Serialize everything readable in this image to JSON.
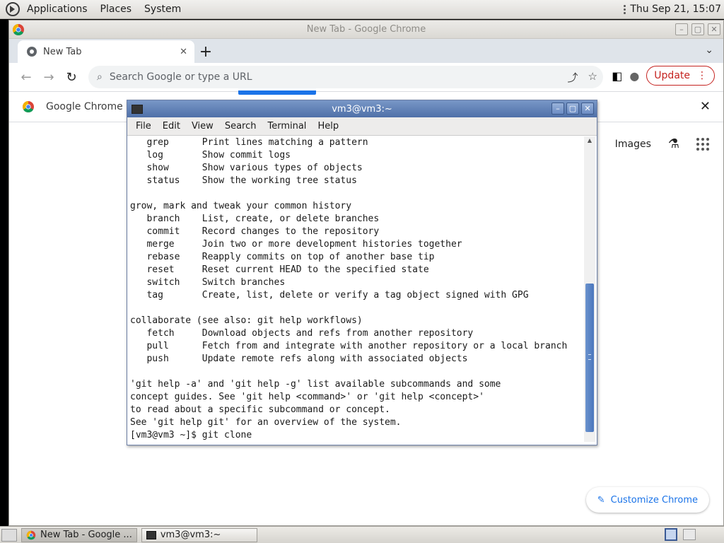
{
  "top_panel": {
    "menus": [
      "Applications",
      "Places",
      "System"
    ],
    "clock": "Thu Sep 21, 15:07"
  },
  "chrome": {
    "window_title": "New Tab - Google Chrome",
    "tab_title": "New Tab",
    "omnibox_placeholder": "Search Google or type a URL",
    "update_label": "Update",
    "infobar_text": "Google Chrome is",
    "images_label": "Images",
    "customize_label": "Customize Chrome"
  },
  "terminal": {
    "title": "vm3@vm3:~",
    "menus": [
      "File",
      "Edit",
      "View",
      "Search",
      "Terminal",
      "Help"
    ],
    "lines": [
      "   grep      Print lines matching a pattern",
      "   log       Show commit logs",
      "   show      Show various types of objects",
      "   status    Show the working tree status",
      "",
      "grow, mark and tweak your common history",
      "   branch    List, create, or delete branches",
      "   commit    Record changes to the repository",
      "   merge     Join two or more development histories together",
      "   rebase    Reapply commits on top of another base tip",
      "   reset     Reset current HEAD to the specified state",
      "   switch    Switch branches",
      "   tag       Create, list, delete or verify a tag object signed with GPG",
      "",
      "collaborate (see also: git help workflows)",
      "   fetch     Download objects and refs from another repository",
      "   pull      Fetch from and integrate with another repository or a local branch",
      "   push      Update remote refs along with associated objects",
      "",
      "'git help -a' and 'git help -g' list available subcommands and some",
      "concept guides. See 'git help <command>' or 'git help <concept>'",
      "to read about a specific subcommand or concept.",
      "See 'git help git' for an overview of the system.",
      "[vm3@vm3 ~]$ git clone "
    ]
  },
  "taskbar": {
    "tasks": [
      "New Tab - Google ...",
      "vm3@vm3:~"
    ]
  },
  "colors": {
    "chrome_blue": "#1a73e8",
    "update_red": "#c5221f",
    "terminal_title": "#5a7bb5"
  }
}
